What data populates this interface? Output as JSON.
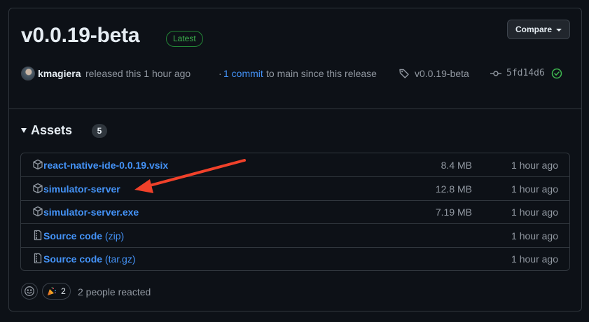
{
  "release": {
    "title": "v0.0.19-beta",
    "latest_label": "Latest",
    "compare_label": "Compare"
  },
  "meta": {
    "author": "kmagiera",
    "released_text": "released this 1 hour ago",
    "separator": "·",
    "commits_link": "1 commit",
    "since_text": "to main since this release",
    "tag": "v0.0.19-beta",
    "commit_sha": "5fd14d6"
  },
  "assets": {
    "title": "Assets",
    "count": "5",
    "items": [
      {
        "name": "react-native-ide-0.0.19.vsix",
        "ext": "",
        "size": "8.4 MB",
        "time": "1 hour ago",
        "icon": "package-icon"
      },
      {
        "name": "simulator-server",
        "ext": "",
        "size": "12.8 MB",
        "time": "1 hour ago",
        "icon": "package-icon"
      },
      {
        "name": "simulator-server.exe",
        "ext": "",
        "size": "7.19 MB",
        "time": "1 hour ago",
        "icon": "package-icon"
      },
      {
        "name": "Source code",
        "ext": " (zip)",
        "size": "",
        "time": "1 hour ago",
        "icon": "file-zip-icon"
      },
      {
        "name": "Source code",
        "ext": " (tar.gz)",
        "size": "",
        "time": "1 hour ago",
        "icon": "file-zip-icon"
      }
    ]
  },
  "reactions": {
    "tada_count": "2",
    "summary": "2 people reacted"
  },
  "colors": {
    "background": "#0d1117",
    "border": "#30363d",
    "link": "#4493f8",
    "success": "#3fb950",
    "annotation_arrow": "#f0412a"
  }
}
